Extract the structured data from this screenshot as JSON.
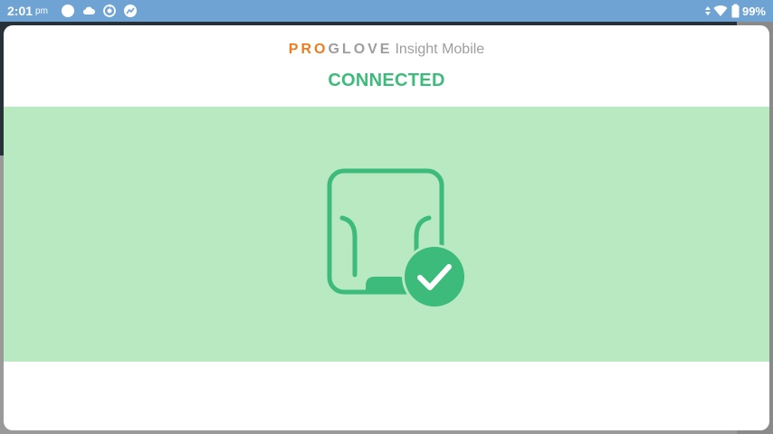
{
  "status_bar": {
    "time": "2:01",
    "ampm": "pm",
    "battery": "99%"
  },
  "dialog": {
    "brand_pro": "PRO",
    "brand_glove": "GLOVE",
    "brand_app": "Insight Mobile",
    "status": "CONNECTED"
  },
  "colors": {
    "status_bar": "#6fa3d4",
    "brand_orange": "#f07c1e",
    "connected_green": "#3dbb7a",
    "panel_green": "#b8e9c1"
  }
}
